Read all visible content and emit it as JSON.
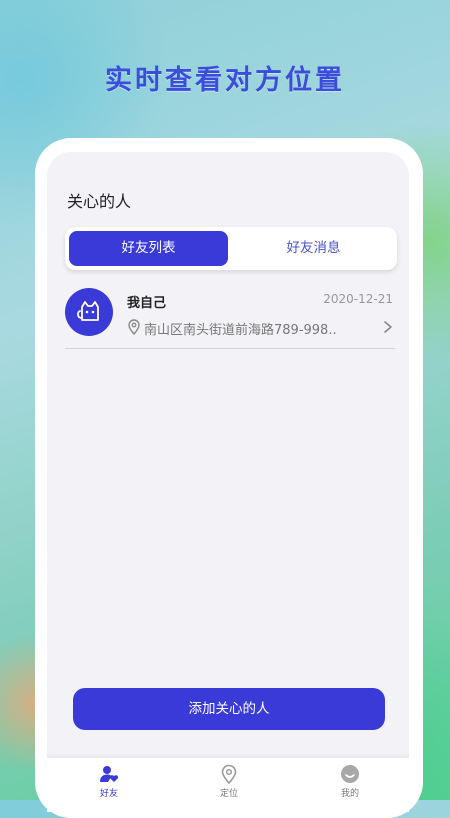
{
  "promo": {
    "title": "实时查看对方位置"
  },
  "page": {
    "title": "关心的人"
  },
  "segment": {
    "tabs": [
      "好友列表",
      "好友消息"
    ],
    "active_index": 0
  },
  "friends": [
    {
      "name": "我自己",
      "date": "2020-12-21",
      "address": "南山区南头街道前海路789-998..",
      "avatar_icon": "cat-icon"
    }
  ],
  "add_button": {
    "label": "添加关心的人"
  },
  "tabbar": {
    "items": [
      {
        "label": "好友",
        "icon": "friend-icon",
        "active": true
      },
      {
        "label": "定位",
        "icon": "location-pin-icon",
        "active": false
      },
      {
        "label": "我的",
        "icon": "face-icon",
        "active": false
      }
    ]
  },
  "colors": {
    "accent": "#3a3ad8",
    "promo_text": "#3b4ddb",
    "screen_bg": "#f3f2f6"
  }
}
